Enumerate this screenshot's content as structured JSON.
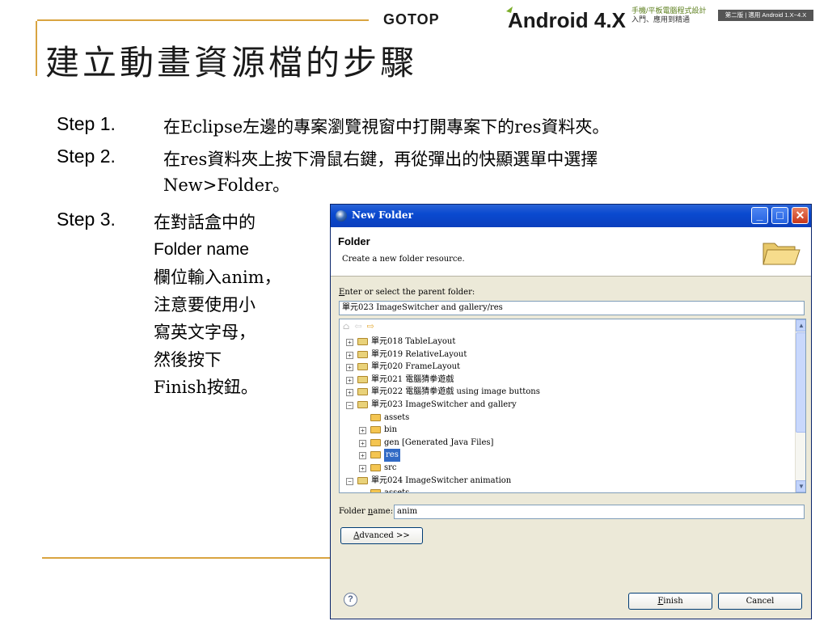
{
  "header": {
    "gotop": "GOTOP",
    "android_brand": "Android 4.X",
    "android_sub_line1": "手機/平板電腦程式設計",
    "android_sub_line2": "入門、應用到精通",
    "edition": "第二版 | 適用 Android 1.X~4.X"
  },
  "slide": {
    "title": "建立動畫資源檔的步驟",
    "steps": [
      {
        "label": "Step 1.",
        "lines": [
          "在Eclipse左邊的專案瀏覽視窗中打開專案下的res資料夾。"
        ]
      },
      {
        "label": "Step 2.",
        "lines": [
          "在res資料夾上按下滑鼠右鍵，再從彈出的快顯選單中選擇",
          "New>Folder。"
        ]
      },
      {
        "label": "Step 3.",
        "lines": [
          "在對話盒中的",
          "Folder name",
          "欄位輸入anim，",
          "注意要使用小",
          "寫英文字母，",
          "然後按下",
          "Finish按鈕。"
        ]
      }
    ]
  },
  "dialog": {
    "title": "New Folder",
    "header_title": "Folder",
    "header_desc": "Create a new folder resource.",
    "parent_label_prefix": "E",
    "parent_label_rest": "nter or select the parent folder:",
    "parent_value": "單元023 ImageSwitcher and gallery/res",
    "tree": [
      {
        "indent": 0,
        "expander": "+",
        "icon": "project-folder-icon",
        "label": "單元018 TableLayout"
      },
      {
        "indent": 0,
        "expander": "+",
        "icon": "project-folder-icon",
        "label": "單元019 RelativeLayout"
      },
      {
        "indent": 0,
        "expander": "+",
        "icon": "project-folder-icon",
        "label": "單元020 FrameLayout"
      },
      {
        "indent": 0,
        "expander": "+",
        "icon": "project-folder-icon",
        "label": "單元021 電腦猜拳遊戲"
      },
      {
        "indent": 0,
        "expander": "+",
        "icon": "project-folder-icon",
        "label": "單元022 電腦猜拳遊戲 using image buttons"
      },
      {
        "indent": 0,
        "expander": "−",
        "icon": "project-folder-icon",
        "label": "單元023 ImageSwitcher and gallery"
      },
      {
        "indent": 1,
        "expander": "",
        "icon": "folder-icon",
        "label": "assets"
      },
      {
        "indent": 1,
        "expander": "+",
        "icon": "folder-icon",
        "label": "bin"
      },
      {
        "indent": 1,
        "expander": "+",
        "icon": "folder-icon",
        "label": "gen [Generated Java Files]"
      },
      {
        "indent": 1,
        "expander": "+",
        "icon": "folder-icon",
        "label": "res",
        "selected": true
      },
      {
        "indent": 1,
        "expander": "+",
        "icon": "folder-icon",
        "label": "src"
      },
      {
        "indent": 0,
        "expander": "−",
        "icon": "project-folder-icon",
        "label": "單元024 ImageSwitcher animation"
      },
      {
        "indent": 1,
        "expander": "",
        "icon": "folder-icon",
        "label": "assets"
      }
    ],
    "folder_name_label_prefix": "Folder ",
    "folder_name_label_u": "n",
    "folder_name_label_rest": "ame:",
    "folder_name_value": "anim",
    "advanced_u": "A",
    "advanced_rest": "dvanced >>",
    "finish_u": "F",
    "finish_rest": "inish",
    "cancel_label": "Cancel",
    "help_glyph": "?"
  },
  "colors": {
    "accent_line": "#d9a441",
    "titlebar": "#0a4ad0",
    "dialog_bg": "#ece9d8",
    "selection": "#316ac5"
  }
}
